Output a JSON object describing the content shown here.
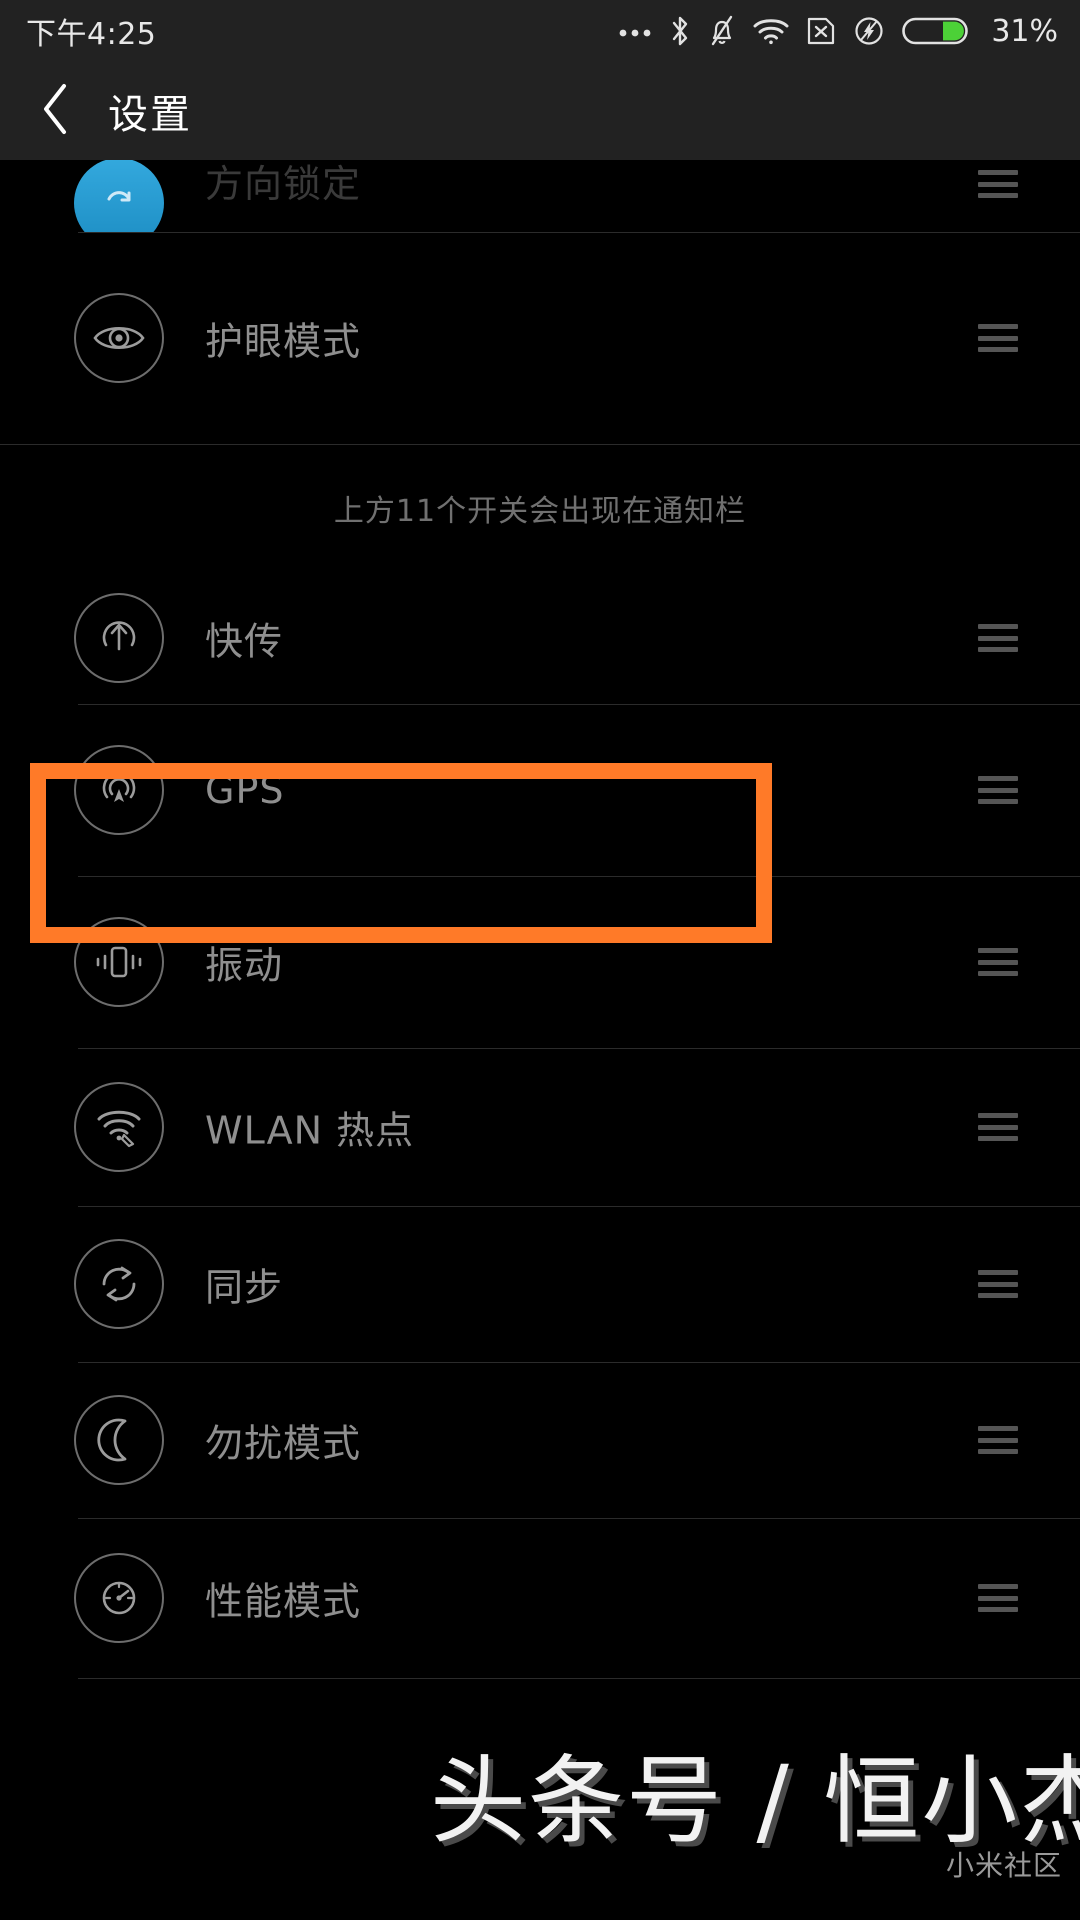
{
  "statusbar": {
    "time": "下午4:25",
    "battery_percent": "31%",
    "icons": [
      "more-dots-icon",
      "bluetooth-icon",
      "bell-muted-icon",
      "wifi-icon",
      "sim-card-off-icon",
      "charging-bolt-icon",
      "battery-icon"
    ],
    "battery_level": 31,
    "battery_fill_color": "#4cd137",
    "background_color": "#222222"
  },
  "appbar": {
    "back_icon": "chevron-left-icon",
    "title": "设置",
    "background_color": "#222222"
  },
  "list": {
    "clipped_top_item": {
      "label": "方向锁定",
      "icon": "rotation-lock-icon",
      "active": true,
      "handle_icon": "drag-handle-icon"
    },
    "items_before_hint": [
      {
        "label": "护眼模式",
        "icon": "eye-icon",
        "handle_icon": "drag-handle-icon"
      }
    ],
    "hint": "上方11个开关会出现在通知栏",
    "items_after_hint": [
      {
        "label": "快传",
        "icon": "upload-arrow-icon",
        "handle_icon": "drag-handle-icon"
      },
      {
        "label": "GPS",
        "icon": "gps-location-icon",
        "handle_icon": "drag-handle-icon",
        "highlighted": true
      },
      {
        "label": "振动",
        "icon": "vibration-icon",
        "handle_icon": "drag-handle-icon"
      },
      {
        "label": "WLAN 热点",
        "icon": "wifi-hotspot-icon",
        "handle_icon": "drag-handle-icon"
      },
      {
        "label": "同步",
        "icon": "sync-refresh-icon",
        "handle_icon": "drag-handle-icon"
      },
      {
        "label": "勿扰模式",
        "icon": "moon-icon",
        "handle_icon": "drag-handle-icon"
      },
      {
        "label": "性能模式",
        "icon": "speedometer-icon",
        "handle_icon": "drag-handle-icon"
      }
    ]
  },
  "highlight": {
    "target": "GPS",
    "color": "#ff7a28"
  },
  "watermark": {
    "main": "头条号 / 恒小杰",
    "sub": "小米社区"
  },
  "colors": {
    "background": "#000000",
    "bar": "#222222",
    "label": "#8f8f8f",
    "icon_stroke": "#6d6d6d",
    "divider": "#2b2b2b",
    "accent_orange": "#ff7a28",
    "active_blue": "#33a8dd"
  }
}
